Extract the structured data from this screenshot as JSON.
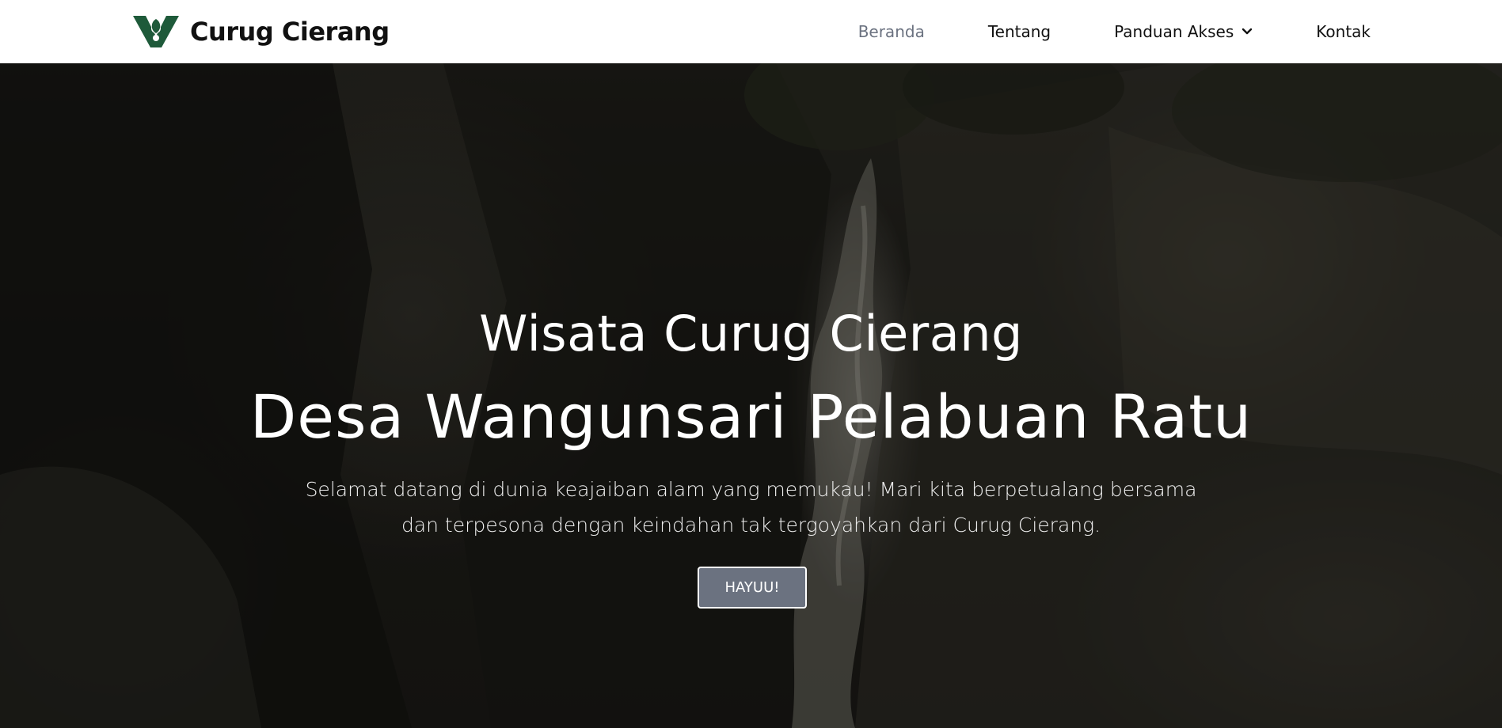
{
  "navbar": {
    "brand_name": "Curug Cierang",
    "brand_logo_icon": "w-leaf-logo-icon",
    "brand_color": "#1e5a3a",
    "items": [
      {
        "label": "Beranda",
        "active": true
      },
      {
        "label": "Tentang",
        "active": false
      },
      {
        "label": "Panduan Akses",
        "active": false,
        "icon": "chevron-down-icon"
      },
      {
        "label": "Kontak",
        "active": false
      }
    ]
  },
  "hero": {
    "subtitle": "Wisata Curug Cierang",
    "title": "Desa Wangunsari Pelabuan Ratu",
    "description": "Selamat datang di dunia keajaiban alam yang memukau! Mari kita berpetualang bersama dan terpesona dengan keindahan tak tergoyahkan dari Curug Cierang.",
    "button_label": "HAYUU!",
    "button_color": "#6b7280",
    "background": "waterfall-photo"
  }
}
